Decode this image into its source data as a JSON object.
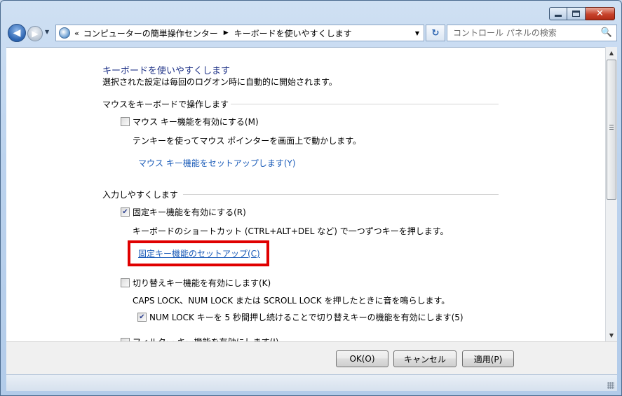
{
  "window": {
    "caption": {
      "minimize": "–",
      "maximize": "□",
      "close": "✕"
    }
  },
  "nav": {
    "back": "◀",
    "forward": "▶",
    "dropdown": "▼",
    "address": {
      "prefix": "«",
      "crumbs": [
        "コンピューターの簡単操作センター",
        "キーボードを使いやすくします"
      ],
      "separator": "▶",
      "dropdown": "▼"
    },
    "refresh": "↻",
    "search": {
      "placeholder": "コントロール パネルの検索",
      "icon": "🔍"
    }
  },
  "content": {
    "title": "キーボードを使いやすくします",
    "subtitle": "選択された設定は毎回のログオン時に自動的に開始されます。",
    "section_mouse": {
      "header": "マウスをキーボードで操作します",
      "mouse_keys": {
        "label": "マウス キー機能を有効にする(M)",
        "checked": false
      },
      "mouse_keys_desc": "テンキーを使ってマウス ポインターを画面上で動かします。",
      "mouse_keys_link": "マウス キー機能をセットアップします(Y)"
    },
    "section_typing": {
      "header": "入力しやすくします",
      "sticky_keys": {
        "label": "固定キー機能を有効にする(R)",
        "checked": true
      },
      "sticky_keys_desc": "キーボードのショートカット (CTRL+ALT+DEL など) で一つずつキーを押します。",
      "sticky_keys_link": "固定キー機能のセットアップ(C)",
      "toggle_keys": {
        "label": "切り替えキー機能を有効にします(K)",
        "checked": false
      },
      "toggle_keys_desc": "CAPS LOCK、NUM LOCK または SCROLL LOCK を押したときに音を鳴らします。",
      "toggle_numlock": {
        "label": "NUM LOCK キーを 5 秒間押し続けることで切り替えキーの機能を有効にします(5)",
        "checked": true
      },
      "filter_keys": {
        "label": "フィルター キー機能を有効にします(I)",
        "checked": false
      }
    }
  },
  "footer": {
    "ok": "OK(O)",
    "cancel": "キャンセル",
    "apply": "適用(P)"
  },
  "colors": {
    "highlight_box": "#e00000",
    "link": "#1a5bb8",
    "title": "#1e3287"
  }
}
